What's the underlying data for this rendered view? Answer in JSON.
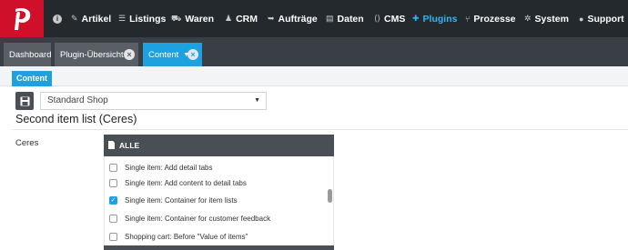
{
  "nav": {
    "items": [
      {
        "icon": "info-icon",
        "label": ""
      },
      {
        "icon": "tag-icon",
        "label": "Artikel"
      },
      {
        "icon": "list-icon",
        "label": "Listings"
      },
      {
        "icon": "cart-icon",
        "label": "Waren"
      },
      {
        "icon": "users-icon",
        "label": "CRM"
      },
      {
        "icon": "truck-icon",
        "label": "Aufträge"
      },
      {
        "icon": "database-icon",
        "label": "Daten"
      },
      {
        "icon": "code-icon",
        "label": "CMS"
      },
      {
        "icon": "puzzle-icon",
        "label": "Plugins"
      },
      {
        "icon": "sitemap-icon",
        "label": "Prozesse"
      },
      {
        "icon": "gear-icon",
        "label": "System"
      },
      {
        "icon": "user-icon",
        "label": "Support"
      }
    ],
    "active": "Plugins",
    "active_color": "#29b6f6"
  },
  "tabs": [
    {
      "label": "Dashboard"
    },
    {
      "label": "Plugin-Übersicht"
    },
    {
      "label": "Content"
    }
  ],
  "subtab": {
    "label": "Content"
  },
  "shop_select": {
    "value": "Standard Shop"
  },
  "page_title": "Second item list (Ceres)",
  "row_label": "Ceres",
  "list": {
    "header": "ALLE",
    "items": [
      {
        "label": "Single item: Add detail tabs",
        "checked": false
      },
      {
        "label": "Single item: Add content to detail tabs",
        "checked": false
      },
      {
        "label": "Single item: Container for item lists",
        "checked": true
      },
      {
        "label": "Single item: Container for customer feedback",
        "checked": false
      },
      {
        "label": "Shopping cart: Before \"Value of items\"",
        "checked": false
      }
    ]
  },
  "colors": {
    "brand": "#d0102b",
    "accent": "#1da1e1",
    "topbar": "#24292e"
  }
}
